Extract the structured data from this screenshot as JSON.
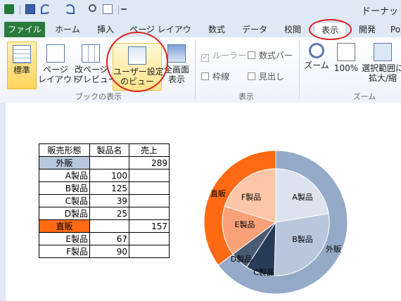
{
  "title_bar": {
    "doc_title": "ドーナッ"
  },
  "tabs": [
    "ファイル",
    "ホーム",
    "挿入",
    "ページ レイアウト",
    "数式",
    "データ",
    "校閲",
    "表示",
    "開発",
    "Po"
  ],
  "ribbon": {
    "view_group": {
      "buttons": [
        "標準",
        "ページ\nレイアウト",
        "改ページ\nプレビュー",
        "ユーザー設定\nのビュー",
        "全画面\n表示"
      ],
      "label": "ブックの表示"
    },
    "show_group": {
      "checkboxes": [
        "ルーラー",
        "数式バー",
        "枠線",
        "見出し"
      ],
      "label": "表示"
    },
    "zoom_group": {
      "buttons": [
        "ズーム",
        "100%",
        "選択範囲に\n拡大/縮"
      ],
      "label": "ズーム"
    }
  },
  "table": {
    "headers": [
      "販売形態",
      "製品名",
      "売上"
    ],
    "rows": [
      [
        "外販",
        "",
        "289"
      ],
      [
        "",
        "A製品",
        "100"
      ],
      [
        "",
        "B製品",
        "125"
      ],
      [
        "",
        "C製品",
        "39"
      ],
      [
        "",
        "D製品",
        "25"
      ],
      [
        "直販",
        "",
        "157"
      ],
      [
        "",
        "E製品",
        "67"
      ],
      [
        "",
        "F製品",
        "90"
      ]
    ]
  },
  "chart_data": {
    "type": "donut",
    "outer": {
      "categories": [
        "外販",
        "直販"
      ],
      "values": [
        289,
        157
      ],
      "colors": [
        "#95a9c8",
        "#ff6a13"
      ]
    },
    "inner": {
      "categories": [
        "A製品",
        "B製品",
        "C製品",
        "D製品",
        "E製品",
        "F製品"
      ],
      "values": [
        100,
        125,
        39,
        25,
        67,
        90
      ],
      "colors": [
        "#dce3ee",
        "#b9c7dc",
        "#273a57",
        "#4a5a72",
        "#f9a27a",
        "#fcc7a6"
      ]
    }
  },
  "colors": {
    "accent": "#2a7a3c",
    "annotation": "#e02020"
  }
}
